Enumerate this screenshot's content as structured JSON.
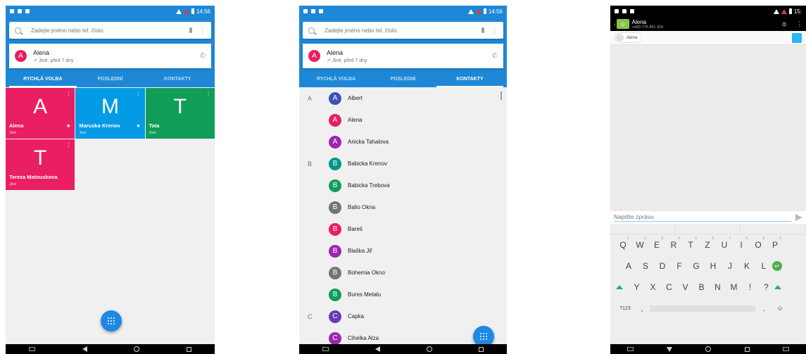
{
  "status": {
    "time": "14:56",
    "time_partial": "15:"
  },
  "search": {
    "placeholder": "Zadejte jméno nebo tel. číslo."
  },
  "recent": {
    "name": "Alena",
    "initial": "A",
    "meta": "Jiné, před 7 dny"
  },
  "tabs": [
    "RYCHLÁ VOLBA",
    "POSLEDNÍ",
    "KONTAKTY"
  ],
  "speed_dial": [
    {
      "letter": "A",
      "name": "Alena",
      "label": "Jiné",
      "color": "#e91e63",
      "starred": true
    },
    {
      "letter": "M",
      "name": "Maruska Krenov",
      "label": "Jiné",
      "color": "#039be5",
      "starred": true
    },
    {
      "letter": "T",
      "name": "Tata",
      "label": "Jiné",
      "color": "#0f9d58",
      "starred": false
    },
    {
      "letter": "T",
      "name": "Tereza Matouskova",
      "label": "Jiné",
      "color": "#e91e63",
      "starred": false
    }
  ],
  "contacts": [
    {
      "section": "A",
      "initial": "A",
      "name": "Albert",
      "color": "#3f51b5"
    },
    {
      "section": "",
      "initial": "A",
      "name": "Alena",
      "color": "#e91e63"
    },
    {
      "section": "",
      "initial": "A",
      "name": "Anicka Tahalova",
      "color": "#9c27b0"
    },
    {
      "section": "B",
      "initial": "B",
      "name": "Babicka Krenov",
      "color": "#009688"
    },
    {
      "section": "",
      "initial": "B",
      "name": "Babicka Trebova",
      "color": "#0f9d58"
    },
    {
      "section": "",
      "initial": "B",
      "name": "Balio Okna",
      "color": "#757575"
    },
    {
      "section": "",
      "initial": "B",
      "name": "Bareš",
      "color": "#e91e63"
    },
    {
      "section": "",
      "initial": "B",
      "name": "Blaška Jiř",
      "color": "#9c27b0"
    },
    {
      "section": "",
      "initial": "B",
      "name": "Bohemia Okno",
      "color": "#757575"
    },
    {
      "section": "",
      "initial": "B",
      "name": "Bures Metalu",
      "color": "#0f9d58"
    },
    {
      "section": "C",
      "initial": "C",
      "name": "Capka",
      "color": "#673ab7"
    },
    {
      "section": "",
      "initial": "C",
      "name": "Cihelka Alza",
      "color": "#9c27b0"
    }
  ],
  "messaging": {
    "name": "Alena",
    "number": "+420 775 851 329",
    "recipient_chip": "Alena",
    "compose_placeholder": "Napište zprávu"
  },
  "keyboard": {
    "row1": [
      {
        "key": "Q",
        "hint": "1"
      },
      {
        "key": "W",
        "hint": "2"
      },
      {
        "key": "E",
        "hint": "3"
      },
      {
        "key": "R",
        "hint": "4"
      },
      {
        "key": "T",
        "hint": "5"
      },
      {
        "key": "Z",
        "hint": "6"
      },
      {
        "key": "U",
        "hint": "7"
      },
      {
        "key": "I",
        "hint": "8"
      },
      {
        "key": "O",
        "hint": "9"
      },
      {
        "key": "P",
        "hint": "0"
      }
    ],
    "row2": [
      "A",
      "S",
      "D",
      "F",
      "G",
      "H",
      "J",
      "K",
      "L"
    ],
    "row3": [
      "Y",
      "X",
      "C",
      "V",
      "B",
      "N",
      "M",
      "!",
      "?"
    ],
    "symbols": "?123",
    "comma": ",",
    "period": "."
  }
}
